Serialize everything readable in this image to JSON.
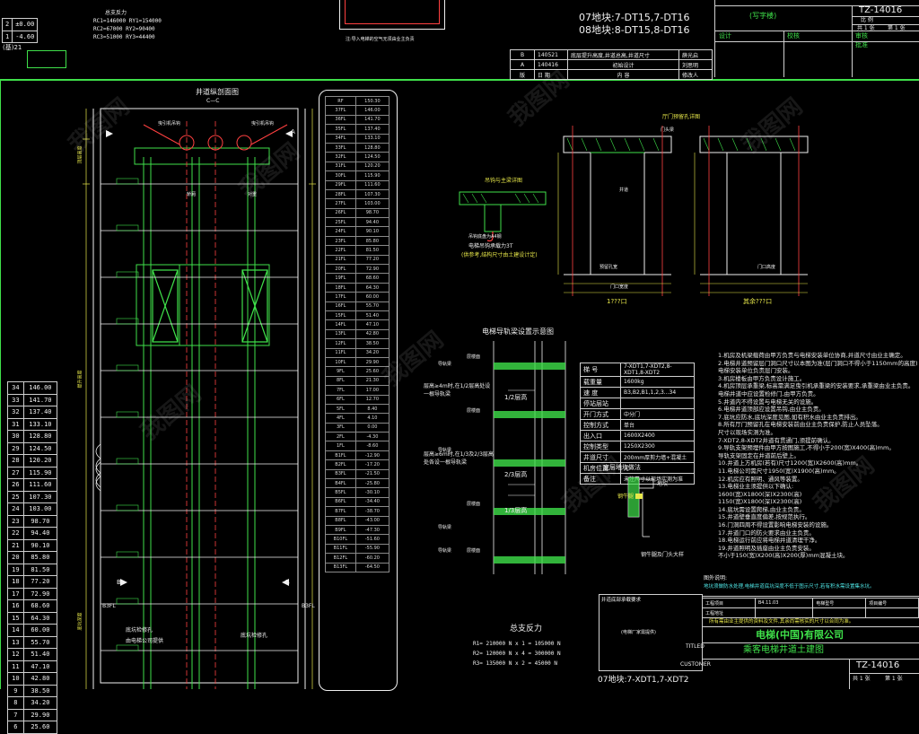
{
  "header": {
    "reaction_title": "总支反力",
    "reactions_top": [
      {
        "l1": "RC1=",
        "v1": "146000",
        "l2": "RY1=",
        "v2": "154000"
      },
      {
        "l1": "RC2=",
        "v1": "67000",
        "l2": "RY2=",
        "v2": "90400"
      },
      {
        "l1": "RC3=",
        "v1": "51000",
        "l2": "RY3=",
        "v2": "44400"
      }
    ],
    "floor_levels_top": [
      {
        "n": "2",
        "v": "±0.00"
      },
      {
        "n": "1",
        "v": "-4.60"
      }
    ],
    "level_label": "(基)21",
    "pit_note": "注:导入电梯的空气无须由业主负责",
    "block_lines": [
      "07地块:7-DT15,7-DT16",
      "08地块:8-DT15,8-DT16"
    ],
    "revisions": [
      {
        "mark": "B",
        "no": "140521",
        "desc": "底层提升高度,井道总高,井道尺寸",
        "by": "薛光启"
      },
      {
        "mark": "A",
        "no": "140416",
        "desc": "初始设计",
        "by": "刘思明"
      },
      {
        "mark": "版",
        "no": "日  期",
        "desc": "内    容",
        "by": "修改人"
      }
    ]
  },
  "title_block_top": {
    "drawing_no": "TZ-14016",
    "sub": "(写字楼)",
    "cells": [
      "设计",
      "校核",
      "审核",
      "批准"
    ],
    "sheet_left": "共 1 张",
    "sheet_right": "第 1 张",
    "scale_label": "比 例"
  },
  "section": {
    "title": "井道纵剖面图",
    "sub": "C—C",
    "labels": [
      "曳引机吊钩",
      "曳引机吊钩",
      "轿厢",
      "对重",
      "B3FL",
      "B3FL",
      "底坑检修孔",
      "由电梯公司提供",
      "底坑检修孔"
    ],
    "side_tags": [
      "A",
      "A",
      "B",
      "B"
    ],
    "dim_texts": [
      "顶层高度",
      "提升高度",
      "底坑深度"
    ]
  },
  "level_table_left": [
    {
      "f": "34",
      "v": "146.00"
    },
    {
      "f": "33",
      "v": "141.70"
    },
    {
      "f": "32",
      "v": "137.40"
    },
    {
      "f": "31",
      "v": "133.10"
    },
    {
      "f": "30",
      "v": "128.80"
    },
    {
      "f": "29",
      "v": "124.50"
    },
    {
      "f": "28",
      "v": "120.20"
    },
    {
      "f": "27",
      "v": "115.90"
    },
    {
      "f": "26",
      "v": "111.60"
    },
    {
      "f": "25",
      "v": "107.30"
    },
    {
      "f": "24",
      "v": "103.00"
    },
    {
      "f": "23",
      "v": "98.70"
    },
    {
      "f": "22",
      "v": "94.40"
    },
    {
      "f": "21",
      "v": "90.10"
    },
    {
      "f": "20",
      "v": "85.80"
    },
    {
      "f": "19",
      "v": "81.50"
    },
    {
      "f": "18",
      "v": "77.20"
    },
    {
      "f": "17",
      "v": "72.90"
    },
    {
      "f": "16",
      "v": "68.60"
    },
    {
      "f": "15",
      "v": "64.30"
    },
    {
      "f": "14",
      "v": "60.00"
    },
    {
      "f": "13",
      "v": "55.70"
    },
    {
      "f": "12",
      "v": "51.40"
    },
    {
      "f": "11",
      "v": "47.10"
    },
    {
      "f": "10",
      "v": "42.80"
    },
    {
      "f": "9",
      "v": "38.50"
    },
    {
      "f": "8",
      "v": "34.20"
    },
    {
      "f": "7",
      "v": "29.90"
    },
    {
      "f": "6",
      "v": "25.60"
    }
  ],
  "level_table_mid": [
    {
      "f": "RF",
      "v": "150.30"
    },
    {
      "f": "37FL",
      "v": "146.00"
    },
    {
      "f": "36FL",
      "v": "141.70"
    },
    {
      "f": "35FL",
      "v": "137.40"
    },
    {
      "f": "34FL",
      "v": "133.10"
    },
    {
      "f": "33FL",
      "v": "128.80"
    },
    {
      "f": "32FL",
      "v": "124.50"
    },
    {
      "f": "31FL",
      "v": "120.20"
    },
    {
      "f": "30FL",
      "v": "115.90"
    },
    {
      "f": "29FL",
      "v": "111.60"
    },
    {
      "f": "28FL",
      "v": "107.30"
    },
    {
      "f": "27FL",
      "v": "103.00"
    },
    {
      "f": "26FL",
      "v": "98.70"
    },
    {
      "f": "25FL",
      "v": "94.40"
    },
    {
      "f": "24FL",
      "v": "90.10"
    },
    {
      "f": "23FL",
      "v": "85.80"
    },
    {
      "f": "22FL",
      "v": "81.50"
    },
    {
      "f": "21FL",
      "v": "77.20"
    },
    {
      "f": "20FL",
      "v": "72.90"
    },
    {
      "f": "19FL",
      "v": "68.60"
    },
    {
      "f": "18FL",
      "v": "64.30"
    },
    {
      "f": "17FL",
      "v": "60.00"
    },
    {
      "f": "16FL",
      "v": "55.70"
    },
    {
      "f": "15FL",
      "v": "51.40"
    },
    {
      "f": "14FL",
      "v": "47.10"
    },
    {
      "f": "13FL",
      "v": "42.80"
    },
    {
      "f": "12FL",
      "v": "38.50"
    },
    {
      "f": "11FL",
      "v": "34.20"
    },
    {
      "f": "10FL",
      "v": "29.90"
    },
    {
      "f": "9FL",
      "v": "25.60"
    },
    {
      "f": "8FL",
      "v": "21.30"
    },
    {
      "f": "7FL",
      "v": "17.00"
    },
    {
      "f": "6FL",
      "v": "12.70"
    },
    {
      "f": "5FL",
      "v": "8.40"
    },
    {
      "f": "4FL",
      "v": "4.10"
    },
    {
      "f": "3FL",
      "v": "0.00"
    },
    {
      "f": "2FL",
      "v": "-4.30"
    },
    {
      "f": "1FL",
      "v": "-8.60"
    },
    {
      "f": "B1FL",
      "v": "-12.90"
    },
    {
      "f": "B2FL",
      "v": "-17.20"
    },
    {
      "f": "B3FL",
      "v": "-21.50"
    },
    {
      "f": "B4FL",
      "v": "-25.80"
    },
    {
      "f": "B5FL",
      "v": "-30.10"
    },
    {
      "f": "B6FL",
      "v": "-34.40"
    },
    {
      "f": "B7FL",
      "v": "-38.70"
    },
    {
      "f": "B8FL",
      "v": "-43.00"
    },
    {
      "f": "B9FL",
      "v": "-47.30"
    },
    {
      "f": "B10FL",
      "v": "-51.60"
    },
    {
      "f": "B11FL",
      "v": "-55.90"
    },
    {
      "f": "B12FL",
      "v": "-60.20"
    },
    {
      "f": "B13FL",
      "v": "-64.50"
    }
  ],
  "hook_detail": {
    "title": "吊钩与主梁详图",
    "label1": "吊钩底盘为A4钢",
    "label2": "电梯吊钩承载力3T",
    "label3": "(供参考,结构尺寸由土建设计定)"
  },
  "door_detail": {
    "title": "厅门预留孔详图",
    "left_caption": "1???口",
    "right_caption": "其余???口",
    "labels": [
      "门头梁",
      "门口宽度",
      "预留孔宽",
      "井道",
      "门口高度"
    ]
  },
  "rail_bracket": {
    "title": "电梯导轨梁设置示意图",
    "labels": [
      "层楼面",
      "层楼面",
      "层楼面",
      "层楼面",
      "导轨梁",
      "导轨梁",
      "导轨梁",
      "导轨梁"
    ],
    "note1": "层高≥4m时,在1/2层高处设一根导轨梁",
    "note2": "层高≥6m时,在1/3及2/3层高处各设一根导轨梁",
    "fractions": [
      "1/2层高",
      "2/3层高",
      "1/3层高"
    ]
  },
  "spec_table": [
    {
      "k": "梯  号",
      "v": "7-XDT1,7-XDT2,8-XDT1,8-XDT2"
    },
    {
      "k": "载重量",
      "v": "1600kg"
    },
    {
      "k": "速  度",
      "v": "B3,B2,B1,1,2,3...34"
    },
    {
      "k": "停站层站",
      "v": ""
    },
    {
      "k": "开门方式",
      "v": "中分门"
    },
    {
      "k": "控制方式",
      "v": "单台"
    },
    {
      "k": "出入口",
      "v": "1600X2400"
    },
    {
      "k": "控制类型",
      "v": "1250X2300"
    },
    {
      "k": "井道尺寸",
      "v": "200mm厚剪力墙+混凝土"
    },
    {
      "k": "机房位置",
      "v": "无"
    },
    {
      "k": "备注",
      "v": "未注尺寸以现场实测为准"
    }
  ],
  "sill_detail": {
    "title": "底层地坎做法",
    "labels": [
      "地坎",
      "钢牛腿"
    ],
    "caption": "钢牛腿及门头大样"
  },
  "notes": {
    "lines": [
      "1.机房及机梁载荷由甲方负责与电梯安装单位协商,井道尺寸由业主确定。",
      "2.电梯井道预留层门洞口尺寸以本图为准(层门洞口不得小于1150mm的高度),",
      "  电梯安装单位负责层门安装。",
      "3.机房楼板由甲方负责设计施工。",
      "4.机房顶层承重梁,标高需满足曳引机承重梁的安装要求,承重梁由业主负责。",
      "  电梯井道中应设置检修门,由甲方负责。",
      "5.井道内不得设置与电梯无关的设施。",
      "6.电梯井道顶部应设置吊钩,由业主负责。",
      "7.底坑应防水,底坑深度见图,如有积水由业主负责排出。",
      "8.所有厅门预留孔在电梯安装前由业主负责保护,防止人员坠落。",
      "  尺寸以现场实测为准。",
      "  7-XDT2,8-XDT2井道有贯通门,须提前确认。",
      "9.导轨支架预埋件由甲方按图施工,不得小于200(宽)X400(高)mm。",
      "  导轨支架固定在井道前后壁上。",
      "10.井道上方机房(若有)尺寸1200(宽)X2600(高)mm。",
      "11.电梯公司需尺寸1950(宽)X1900(高)mm。",
      "12.机房应有照明、通风等装置。",
      "13.电梯业主须提供以下确认:",
      "  1600(宽)X1800(深)X2300(高)",
      "  1150(宽)X1800(深)X2300(高)",
      "14.底坑需设置爬梯,由业主负责。",
      "15.井道壁垂直度偏差,按规范执行。",
      "16.门洞四周不得设置影响电梯安装的设施。",
      "17.井道门口的防火要求由业主负责。",
      "18.电梯运行前应将电梯井道清理干净。",
      "19.井道照明及插座由业主负责安装。",
      "  不小于150(宽)X200(高)X200(厚)mm混凝土块。"
    ]
  },
  "special": {
    "title": "图外说明:",
    "text": "地坑须做防水处理,电梯井道底坑深度不低于图示尺寸,若有积水需设置集水坑。"
  },
  "bottom_reactions": {
    "title": "总支反力",
    "rows": [
      {
        "l": "R1=",
        "v": "210000",
        "eq": "N x 1 = 105000",
        "u": "N"
      },
      {
        "l": "R2=",
        "v": "120000",
        "eq": "N x 4 = 300000",
        "u": "N"
      },
      {
        "l": "R3=",
        "v": "135000",
        "eq": "N x 2 = 45000",
        "u": "N"
      }
    ],
    "block": "07地块:7-XDT1,7-XDT2",
    "pit_title": "井道底部承载要求",
    "pit_note": "(电梯厂家需提供)"
  },
  "company": {
    "name": "电梯(中国)有限公司",
    "drawing_title": "乘客电梯井道土建图",
    "titled_label": "TITLED",
    "customer_label": "CUSTOMER",
    "drawing_no": "TZ-14016",
    "sheet_left": "共 1 张",
    "sheet_right": "第 1 张",
    "info_rows": [
      [
        "工程项目",
        "B4.11.03",
        "电梯型号",
        "项目编号"
      ],
      [
        "工程地址",
        "",
        "",
        ""
      ]
    ],
    "footer_note": "所有需由业主提供的资料及文件,其余尚需核实的尺寸以合同为准。"
  },
  "watermarks": [
    "我图网",
    "我图网",
    "我图网",
    "我图网",
    "我图网",
    "我图网",
    "我图网",
    "我图网"
  ],
  "colors": {
    "green": "#3fe04a",
    "yellow": "#e8e84a",
    "red": "#ff4040",
    "cyan": "#50e8e8",
    "white": "#f0f0f0"
  }
}
